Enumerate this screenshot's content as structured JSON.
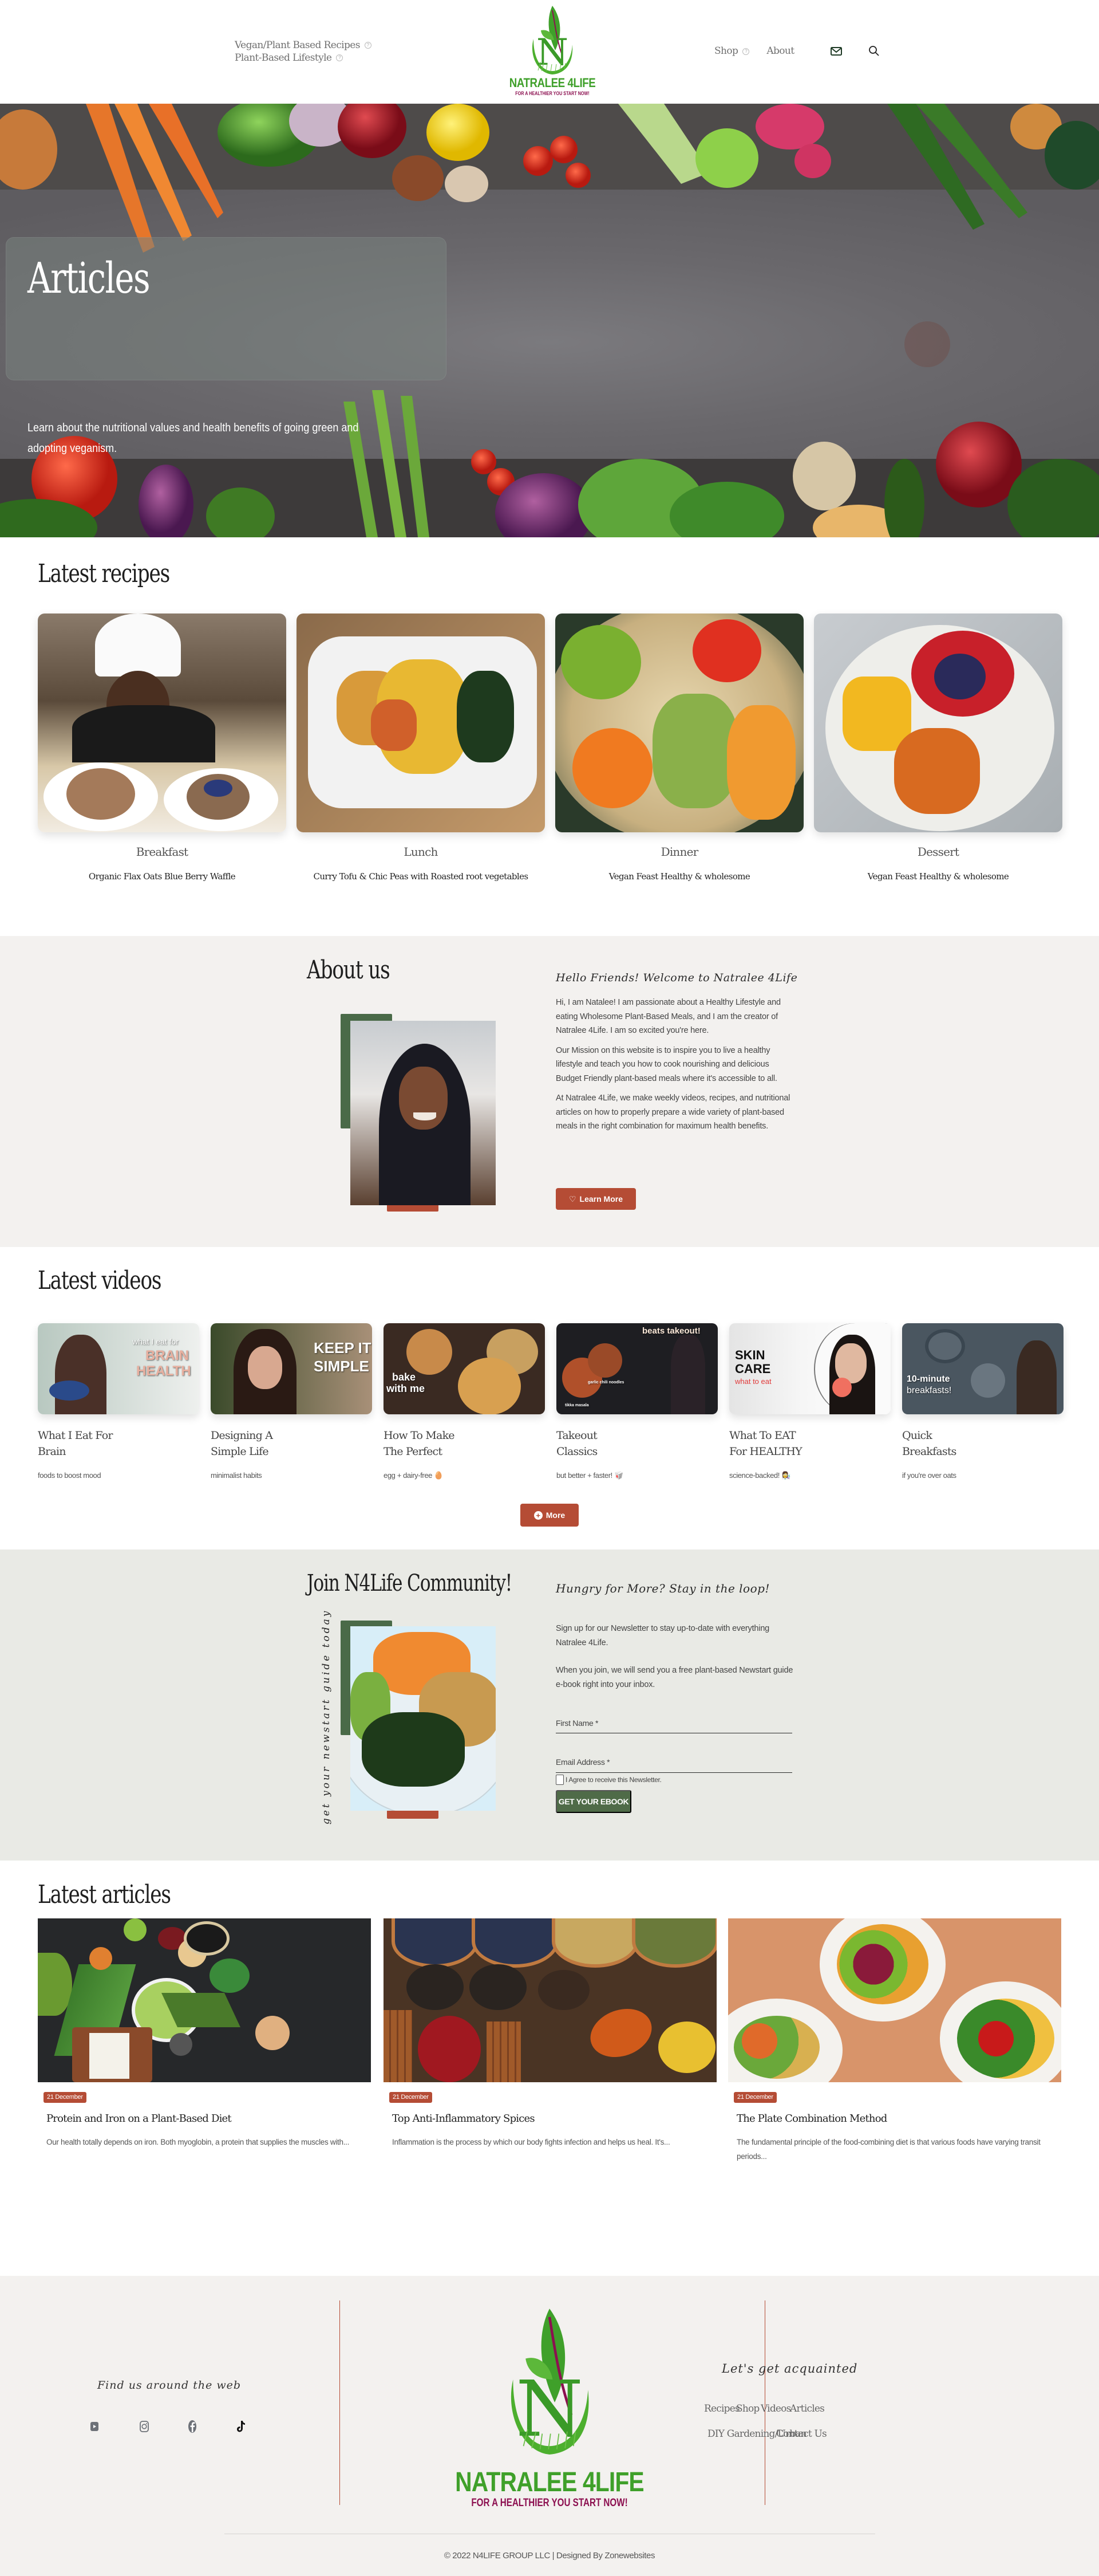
{
  "header": {
    "nav_left": [
      {
        "label": "Vegan/Plant Based Recipes",
        "has_submenu": true
      },
      {
        "label": "Plant-Based Lifestyle",
        "has_submenu": true
      }
    ],
    "nav_right": [
      {
        "label": "Shop",
        "has_submenu": true
      },
      {
        "label": "About",
        "has_submenu": false
      }
    ],
    "icons": {
      "mail": "mail-icon",
      "search": "search-icon"
    },
    "logo": {
      "brand": "NATRALEE 4LIFE",
      "tagline": "FOR A HEALTHIER YOU START NOW!"
    }
  },
  "hero": {
    "title": "Articles",
    "subtitle": "Learn about the nutritional values and health benefits of going green and adopting veganism."
  },
  "recipes": {
    "heading": "Latest recipes",
    "items": [
      {
        "category": "Breakfast",
        "title": "Organic Flax Oats Blue Berry Waffle"
      },
      {
        "category": "Lunch",
        "title": "Curry Tofu & Chic Peas with Roasted root vegetables"
      },
      {
        "category": "Dinner",
        "title": "Vegan Feast Healthy & wholesome"
      },
      {
        "category": "Dessert",
        "title": "Vegan Feast Healthy & wholesome"
      }
    ]
  },
  "about": {
    "heading": "About us",
    "greeting": "Hello Friends! Welcome to Natralee 4Life",
    "paragraphs": [
      "Hi, I am Natalee! I am passionate about a Healthy Lifestyle and eating Wholesome Plant-Based Meals, and I am the creator of Natralee 4Life. I am so excited you're here.",
      "Our Mission on this website is to inspire you to live a healthy lifestyle and teach you how to cook nourishing and delicious Budget Friendly plant-based meals where it's accessible to all.",
      "At Natralee 4Life, we make weekly videos, recipes, and nutritional articles on how to properly prepare a wide variety of plant-based meals in the right combination for maximum health benefits."
    ],
    "button_label": "Learn More",
    "button_icon": "heart-icon"
  },
  "videos": {
    "heading": "Latest videos",
    "items": [
      {
        "title_line1": "What I Eat For",
        "title_line2": "Brain",
        "subtitle": "foods to boost mood",
        "thumb_lines": [
          "what I eat for",
          "BRAIN",
          "HEALTH"
        ]
      },
      {
        "title_line1": "Designing A",
        "title_line2": "Simple Life",
        "subtitle": "minimalist habits",
        "thumb_lines": [
          "KEEP IT",
          "SIMPLE"
        ]
      },
      {
        "title_line1": "How To Make",
        "title_line2": "The Perfect",
        "subtitle": "egg + dairy-free 🥚",
        "thumb_lines": [
          "bake",
          "with me"
        ]
      },
      {
        "title_line1": "Takeout",
        "title_line2": "Classics",
        "subtitle": "but better + faster! 🥡",
        "thumb_lines": [
          "beats takeout!",
          "garlic chili noodles",
          "tikka masala"
        ]
      },
      {
        "title_line1": "What To EAT",
        "title_line2": "For HEALTHY",
        "subtitle": "science-backed! 👩‍🔬",
        "thumb_lines": [
          "SKIN",
          "CARE",
          "what to eat"
        ]
      },
      {
        "title_line1": "Quick",
        "title_line2": "Breakfasts",
        "subtitle": "if you're over oats",
        "thumb_lines": [
          "10-minute",
          "breakfasts!"
        ]
      }
    ],
    "more_label": "More",
    "more_icon": "plus-circle-icon"
  },
  "community": {
    "heading": "Join N4Life Community!",
    "vertical_text": "get your newstart guide today",
    "subheading": "Hungry for More? Stay in the loop!",
    "paragraphs": [
      "Sign up for our Newsletter to stay up-to-date with everything Natralee 4Life.",
      "When you join, we will send you a free plant-based Newstart guide e-book right into your inbox."
    ],
    "first_name_label": "First Name *",
    "first_name_value": "",
    "email_label": "Email Address *",
    "email_value": "",
    "agree_label": "I Agree to receive this Newsletter.",
    "agree_checked": false,
    "submit_label": "GET YOUR EBOOK"
  },
  "articles": {
    "heading": "Latest articles",
    "items": [
      {
        "date": "21 December",
        "title": "Protein and Iron on a Plant-Based Diet",
        "excerpt": "Our health totally depends on iron. Both myoglobin, a protein that supplies the muscles with..."
      },
      {
        "date": "21 December",
        "title": "Top Anti-Inflammatory Spices",
        "excerpt": "Inflammation is the process by which our body fights infection and helps us heal. It's..."
      },
      {
        "date": "21 December",
        "title": "The Plate Combination Method",
        "excerpt": "The fundamental principle of the food-combining diet is that various foods have varying transit periods..."
      }
    ]
  },
  "footer": {
    "social_heading": "Find us around the web",
    "social": [
      {
        "name": "youtube-icon"
      },
      {
        "name": "instagram-icon"
      },
      {
        "name": "facebook-icon"
      },
      {
        "name": "tiktok-icon"
      }
    ],
    "logo": {
      "brand": "NATRALEE 4LIFE",
      "tagline": "FOR A HEALTHIER YOU START NOW!"
    },
    "links_heading": "Let's get acquainted",
    "links": [
      "Recipes",
      "Shop",
      "Videos",
      "Articles",
      "DIY Gardening/Urban",
      "Contact Us"
    ],
    "copyright": "© 2022 N4LIFE GROUP LLC | Designed By Zonewebsites"
  },
  "colors": {
    "accent_red": "#b54c35",
    "accent_green": "#4f6b48",
    "logo_green": "#3fa02a",
    "logo_magenta": "#8c1050",
    "section_bg": "#f3f1ef",
    "community_bg": "#e9eae5"
  }
}
